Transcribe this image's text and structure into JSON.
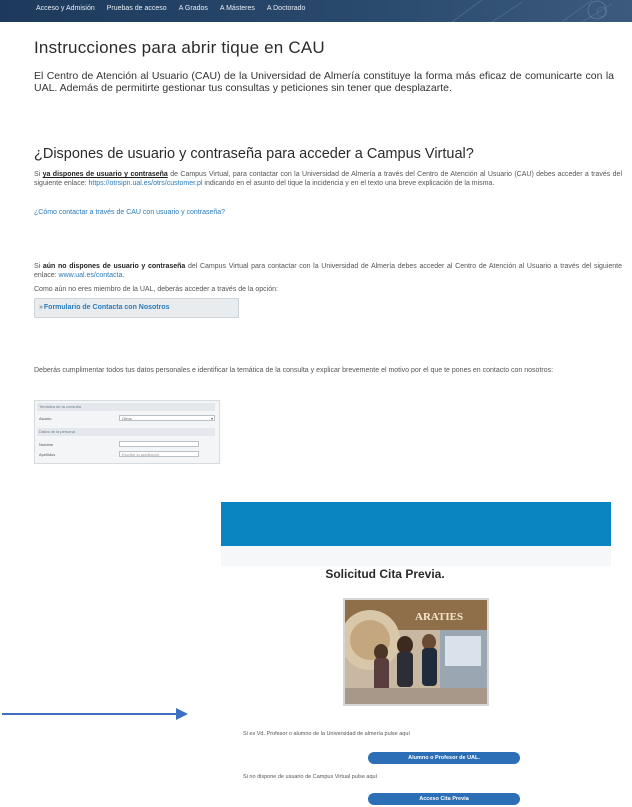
{
  "nav": {
    "items": [
      "Acceso y Admisión",
      "Pruebas de acceso",
      "A Grados",
      "A Másteres",
      "A Doctorado"
    ]
  },
  "title": "Instrucciones para abrir tique en CAU",
  "intro": "El Centro de Atención al Usuario (CAU) de la Universidad de Almería constituye la forma más eficaz de comunicarte con la UAL. Además de permitirte gestionar tus consultas y peticiones sin tener que desplazarte.",
  "section": {
    "heading": "¿Dispones de usuario y contraseña para acceder a Campus Virtual?",
    "p1_prefix": "Si ",
    "p1_bold": "ya dispones de usuario y contraseña",
    "p1_mid": " de Campus Virtual, para contactar con la Universidad de Almería a través del Centro de Atención al Usuario (CAU) debes acceder a través del siguiente enlace: ",
    "p1_link": "https://otrsipn.ual.es/otrs/customer.pl",
    "p1_suffix": " indicando en el asunto del tique la incidencia y en el texto una breve explicación de la misma.",
    "how_link": "¿Cómo contactar a través de CAU con usuario y contraseña?",
    "p2_prefix": "Si ",
    "p2_bold": "aún no dispones de usuario y contraseña",
    "p2_mid": " del Campus Virtual para contactar con la Universidad de Almería debes acceder al Centro de Atención al Usuario a través del siguiente enlace: ",
    "p2_link": "www.ual.es/contacta",
    "p2_suffix": ".",
    "p3": "Como aún no eres miembro de la UAL, deberás acceder a través de la opción:",
    "form_button": "Formulario de Contacta con Nosotros",
    "p4": "Deberás cumplimentar todos tus datos personales e identificar la temática de la consulta y explicar brevemente el motivo por el que te pones en contacto con nosotros:"
  },
  "miniform": {
    "section1": "Temática de la consulta",
    "label_asunto": "Asunto",
    "select_value": "Otros",
    "section2": "Datos de la persona",
    "label_nombre": "Nombre",
    "label_apellidos": "Apellidos",
    "input_placeholder": "Escribe tu apellido(s)"
  },
  "cita": {
    "title": "Solicitud Cita Previa.",
    "photo_sign": "ARATIES",
    "text1": "Si es Vd. Profesor o alumno de la Universidad de almería pulse aquí",
    "button1": "Alumno o Profesor de UAL.",
    "text2": "Si no dispone de usuario de Campus Virtual pulse aquí",
    "button2": "Acceso Cita Previa"
  },
  "colors": {
    "nav_bg": "#1d3a5c",
    "panel_header": "#0b84c2",
    "pill": "#2c6fb6",
    "link": "#2a7ab8",
    "arrow": "#3a6fc4"
  }
}
